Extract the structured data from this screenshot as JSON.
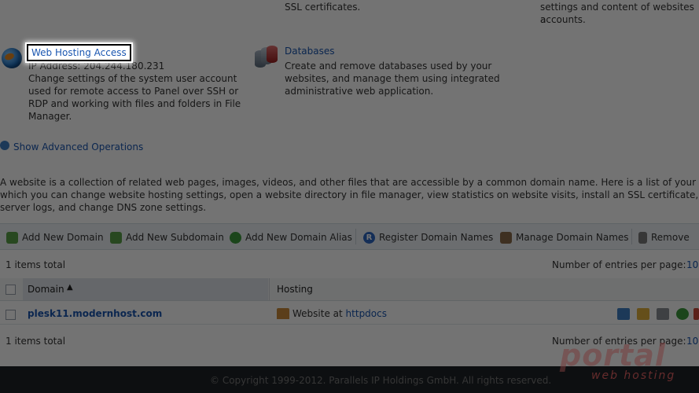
{
  "top_fragments": {
    "left": "SSL certificates.",
    "right_line1": "settings and content of websites a",
    "right_line2": "accounts."
  },
  "hosting_access": {
    "title": "Web Hosting Access",
    "ip": "IP Address: 204.244.180.231",
    "desc_lines": [
      "Change settings of the system user account",
      "used for remote access to Panel over SSH or",
      "RDP and working with files and folders in File",
      "Manager."
    ]
  },
  "databases": {
    "title": "Databases",
    "desc_lines": [
      "Create and remove databases used by your",
      "websites, and manage them using integrated",
      "administrative web application."
    ]
  },
  "advanced": {
    "label": "Show Advanced Operations"
  },
  "intro_lines": [
    "A website is a collection of related web pages, images, videos, and other files that are accessible by a common domain name. Here is a list of your web",
    "which you can change website hosting settings, open a website directory in file manager, view statistics on website visits, install an SSL certificate, vie",
    "server logs, and change DNS zone settings."
  ],
  "toolbar": {
    "add_domain": "Add New Domain",
    "add_subdomain": "Add New Subdomain",
    "add_alias": "Add New Domain Alias",
    "register": "Register Domain Names",
    "manage": "Manage Domain Names",
    "remove": "Remove"
  },
  "list": {
    "total_top": "1 items total",
    "total_bottom": "1 items total",
    "per_page_label": "Number of entries per page:",
    "per_page_value": "10",
    "columns": {
      "domain": "Domain",
      "hosting": "Hosting"
    },
    "rows": [
      {
        "domain": "plesk11.modernhost.com",
        "hosting_prefix": "Website at",
        "hosting_link": "httpdocs"
      }
    ]
  },
  "footer": {
    "copyright": "© Copyright 1999-2012. Parallels IP Holdings GmbH. All rights reserved."
  },
  "watermark": {
    "main": "portal",
    "sub": "web hosting"
  }
}
